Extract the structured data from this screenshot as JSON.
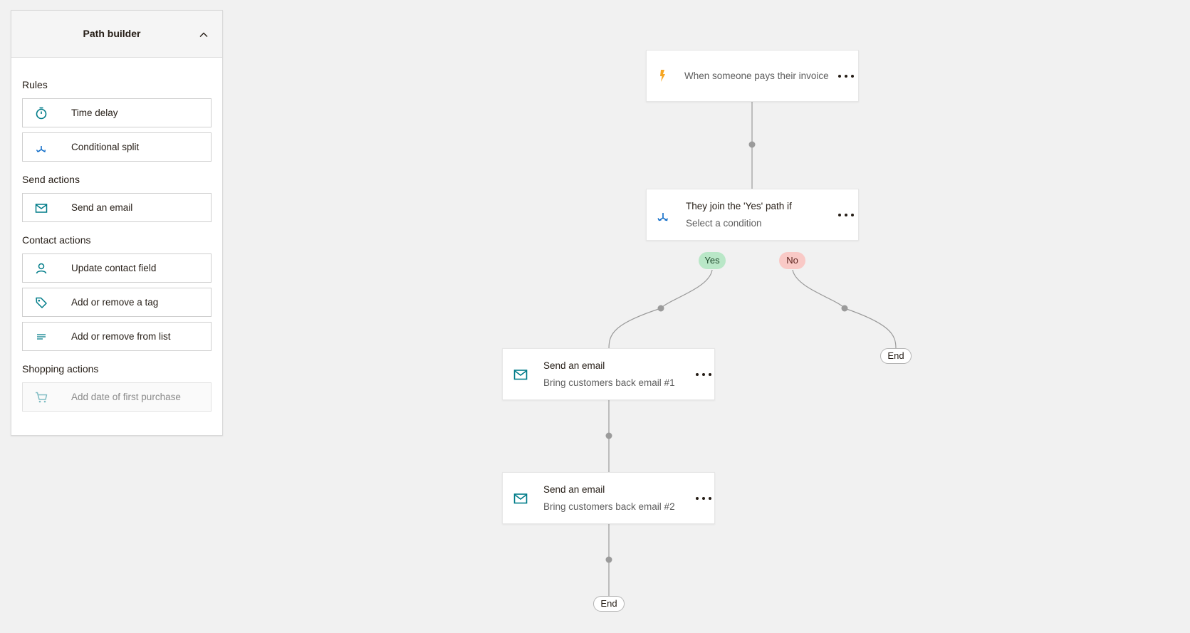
{
  "sidebar": {
    "title": "Path builder",
    "sections": [
      {
        "label": "Rules",
        "items": [
          {
            "label": "Time delay",
            "icon": "stopwatch-icon"
          },
          {
            "label": "Conditional split",
            "icon": "split-arrows-icon"
          }
        ]
      },
      {
        "label": "Send actions",
        "items": [
          {
            "label": "Send an email",
            "icon": "envelope-icon"
          }
        ]
      },
      {
        "label": "Contact actions",
        "items": [
          {
            "label": "Update contact field",
            "icon": "person-icon"
          },
          {
            "label": "Add or remove a tag",
            "icon": "tag-icon"
          },
          {
            "label": "Add or remove from list",
            "icon": "list-lines-icon"
          }
        ]
      },
      {
        "label": "Shopping actions",
        "items": [
          {
            "label": "Add date of first purchase",
            "icon": "cart-icon",
            "disabled": true
          }
        ]
      }
    ]
  },
  "flow": {
    "trigger": {
      "label": "When someone pays their invoice",
      "icon": "lightning-icon"
    },
    "split": {
      "title": "They join the 'Yes' path if",
      "subtitle": "Select a condition",
      "icon": "split-arrows-icon"
    },
    "yes_label": "Yes",
    "no_label": "No",
    "email1": {
      "title": "Send an email",
      "subtitle": "Bring customers back email #1",
      "icon": "envelope-icon"
    },
    "email2": {
      "title": "Send an email",
      "subtitle": "Bring customers back email #2",
      "icon": "envelope-icon"
    },
    "end_no": "End",
    "end_yes": "End"
  },
  "colors": {
    "teal": "#007c89",
    "blue": "#0a69c7",
    "lightning": "#f6a623",
    "connector": "#9b9b9b",
    "yes_pill": "#b9e7c7",
    "no_pill": "#f9c9c6"
  }
}
